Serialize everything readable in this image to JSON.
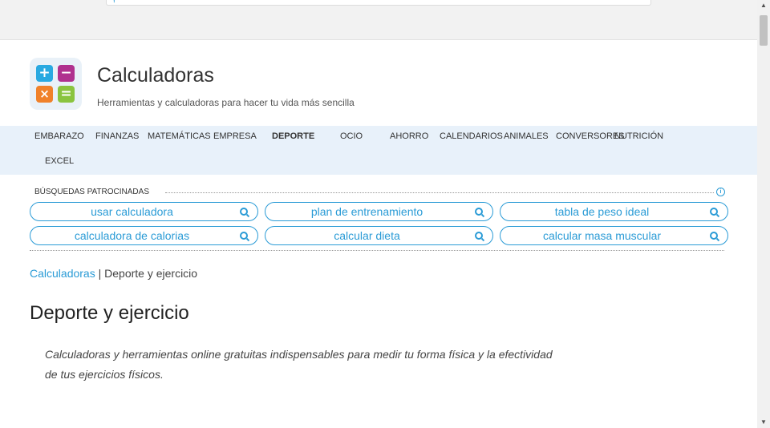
{
  "header": {
    "title": "Calculadoras",
    "tagline": "Herramientas y calculadoras para hacer tu vida más sencilla"
  },
  "nav": {
    "items": [
      "EMBARAZO",
      "FINANZAS",
      "MATEMÁTICAS",
      "EMPRESA",
      "DEPORTE",
      "OCIO",
      "AHORRO",
      "CALENDARIOS",
      "ANIMALES",
      "CONVERSORES",
      "NUTRICIÓN",
      "EXCEL"
    ],
    "active": "DEPORTE"
  },
  "sponsored": {
    "label": "BÚSQUEDAS PATROCINADAS",
    "pills": [
      "usar calculadora",
      "plan de entrenamiento",
      "tabla de peso ideal",
      "calculadora de calorias",
      "calcular dieta",
      "calcular masa muscular"
    ]
  },
  "breadcrumb": {
    "root": "Calculadoras",
    "separator": " | ",
    "current": "Deporte y ejercicio"
  },
  "page": {
    "title": "Deporte y ejercicio",
    "intro": "Calculadoras y herramientas online gratuitas indispensables para medir tu forma física y la efectividad de tus ejercicios físicos."
  },
  "logo": {
    "symbols": [
      "+",
      "−",
      "×",
      "="
    ]
  },
  "colors": {
    "accent": "#2a9bd6",
    "nav_bg": "#e8f1fa"
  }
}
